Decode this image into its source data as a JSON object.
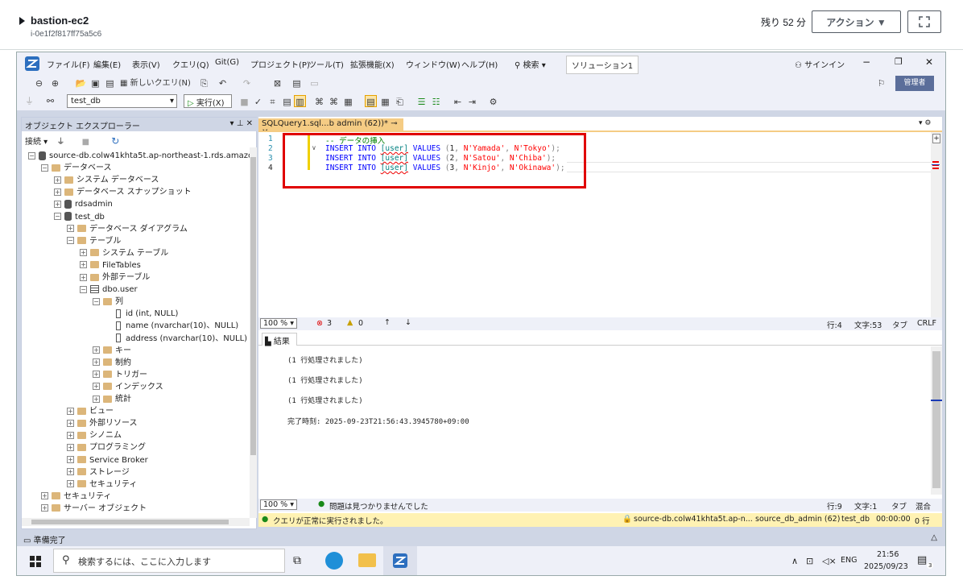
{
  "session": {
    "instance_name": "bastion-ec2",
    "instance_id": "i-0e1f2f817ff75a5c6",
    "remaining": "残り 52 分",
    "action_label": "アクション ▼"
  },
  "ssms": {
    "menu": [
      "ファイル(F)",
      "編集(E)",
      "表示(V)",
      "クエリ(Q)",
      "Git(G)",
      "プロジェクト(P)",
      "ツール(T)",
      "拡張機能(X)",
      "ウィンドウ(W)",
      "ヘルプ(H)"
    ],
    "search_label": "検索",
    "solution_label": "ソリューション1",
    "signin_label": "サインイン",
    "admin_badge": "管理者",
    "new_query_label": "新しいクエリ(N)",
    "database_selected": "test_db",
    "execute_label": "実行(X)"
  },
  "object_explorer": {
    "title": "オブジェクト エクスプローラー",
    "connect_label": "接続",
    "nodes": [
      {
        "label": "source-db.colw41khta5t.ap-northeast-1.rds.amazonaw",
        "indent": 0,
        "exp": "−",
        "icon": "server"
      },
      {
        "label": "データベース",
        "indent": 1,
        "exp": "−",
        "icon": "folder"
      },
      {
        "label": "システム データベース",
        "indent": 2,
        "exp": "+",
        "icon": "folder"
      },
      {
        "label": "データベース スナップショット",
        "indent": 2,
        "exp": "+",
        "icon": "folder"
      },
      {
        "label": "rdsadmin",
        "indent": 2,
        "exp": "+",
        "icon": "db"
      },
      {
        "label": "test_db",
        "indent": 2,
        "exp": "−",
        "icon": "db"
      },
      {
        "label": "データベース ダイアグラム",
        "indent": 3,
        "exp": "+",
        "icon": "folder"
      },
      {
        "label": "テーブル",
        "indent": 3,
        "exp": "−",
        "icon": "folder"
      },
      {
        "label": "システム テーブル",
        "indent": 4,
        "exp": "+",
        "icon": "folder"
      },
      {
        "label": "FileTables",
        "indent": 4,
        "exp": "+",
        "icon": "folder"
      },
      {
        "label": "外部テーブル",
        "indent": 4,
        "exp": "+",
        "icon": "folder"
      },
      {
        "label": "dbo.user",
        "indent": 4,
        "exp": "−",
        "icon": "table"
      },
      {
        "label": "列",
        "indent": 5,
        "exp": "−",
        "icon": "folder"
      },
      {
        "label": "id (int, NULL)",
        "indent": 6,
        "exp": "",
        "icon": "column"
      },
      {
        "label": "name (nvarchar(10)、NULL)",
        "indent": 6,
        "exp": "",
        "icon": "column"
      },
      {
        "label": "address (nvarchar(10)、NULL)",
        "indent": 6,
        "exp": "",
        "icon": "column"
      },
      {
        "label": "キー",
        "indent": 5,
        "exp": "+",
        "icon": "folder"
      },
      {
        "label": "制約",
        "indent": 5,
        "exp": "+",
        "icon": "folder"
      },
      {
        "label": "トリガー",
        "indent": 5,
        "exp": "+",
        "icon": "folder"
      },
      {
        "label": "インデックス",
        "indent": 5,
        "exp": "+",
        "icon": "folder"
      },
      {
        "label": "統計",
        "indent": 5,
        "exp": "+",
        "icon": "folder"
      },
      {
        "label": "ビュー",
        "indent": 3,
        "exp": "+",
        "icon": "folder"
      },
      {
        "label": "外部リソース",
        "indent": 3,
        "exp": "+",
        "icon": "folder"
      },
      {
        "label": "シノニム",
        "indent": 3,
        "exp": "+",
        "icon": "folder"
      },
      {
        "label": "プログラミング",
        "indent": 3,
        "exp": "+",
        "icon": "folder"
      },
      {
        "label": "Service Broker",
        "indent": 3,
        "exp": "+",
        "icon": "folder"
      },
      {
        "label": "ストレージ",
        "indent": 3,
        "exp": "+",
        "icon": "folder"
      },
      {
        "label": "セキュリティ",
        "indent": 3,
        "exp": "+",
        "icon": "folder"
      },
      {
        "label": "セキュリティ",
        "indent": 1,
        "exp": "+",
        "icon": "folder"
      },
      {
        "label": "サーバー オブジェクト",
        "indent": 1,
        "exp": "+",
        "icon": "folder"
      }
    ]
  },
  "editor": {
    "tab_title": "SQLQuery1.sql...b admin (62))*",
    "line_numbers": [
      "1",
      "2",
      "3",
      "4"
    ],
    "comment": "-- データの挿入",
    "rows": [
      {
        "id": "1",
        "name": "N'Yamada'",
        "addr": "N'Tokyo'"
      },
      {
        "id": "2",
        "name": "N'Satou'",
        "addr": "N'Chiba'"
      },
      {
        "id": "3",
        "name": "N'Kinjo'",
        "addr": "N'Okinawa'"
      }
    ],
    "kw_insert": "INSERT INTO",
    "table_name": "[user]",
    "kw_values": "VALUES",
    "zoom": "100 %",
    "errors": "3",
    "warnings": "0",
    "line": "行:4",
    "col": "文字:53",
    "tab_mode": "タブ",
    "eol": "CRLF"
  },
  "results": {
    "tab_label": "結果",
    "messages": [
      "(1 行処理されました)",
      "(1 行処理されました)",
      "(1 行処理されました)"
    ],
    "completion": "完了時刻: 2025-09-23T21:56:43.3945780+09:00",
    "zoom": "100 %",
    "issues": "問題は見つかりませんでした",
    "line": "行:9",
    "col": "文字:1",
    "tab_mode": "タブ",
    "eol": "混合"
  },
  "query_status": {
    "message": "クエリが正常に実行されました。",
    "server": "source-db.colw41khta5t.ap-n...",
    "user": "source_db_admin (62)",
    "db": "test_db",
    "time": "00:00:00",
    "rows": "0 行"
  },
  "status_bar": {
    "ready": "準備完了"
  },
  "taskbar": {
    "search_placeholder": "検索するには、ここに入力します",
    "lang": "ENG",
    "time": "21:56",
    "date": "2025/09/23",
    "notif_count": "3"
  }
}
